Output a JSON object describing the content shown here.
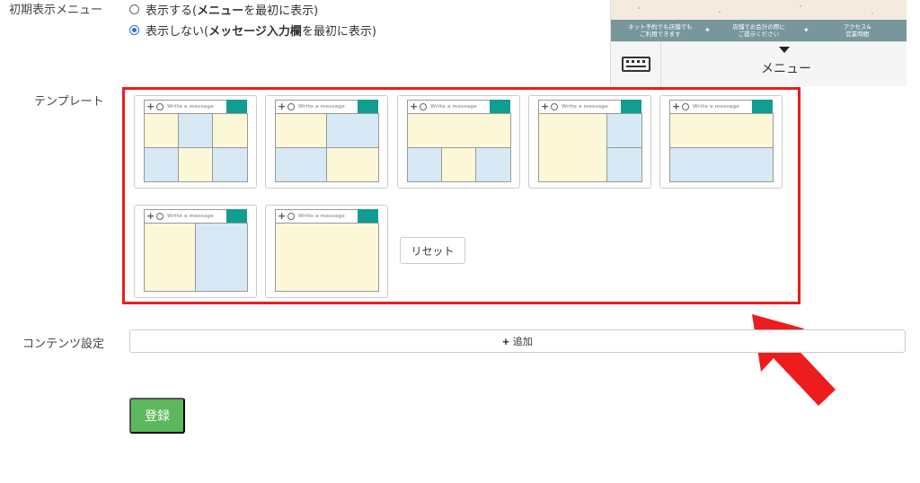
{
  "initial_menu": {
    "label": "初期表示メニュー",
    "options": [
      {
        "text_before": "表示する(",
        "bold": "メニュー",
        "text_after": "を最初に表示)",
        "selected": false
      },
      {
        "text_before": "表示しない(",
        "bold": "メッセージ入力欄",
        "text_after": "を最初に表示)",
        "selected": true
      }
    ]
  },
  "preview": {
    "band_items": [
      "ネット予約でも店舗でも\nご利用できます",
      "店舗でお会計の際に\nご提示ください",
      "アクセス&\n営業時間"
    ],
    "menu_label": "メニュー",
    "keyboard_icon": "keyboard-icon"
  },
  "templates": {
    "label": "テンプレート",
    "message_placeholder": "Write a message",
    "reset_label": "リセット"
  },
  "content_settings": {
    "label": "コンテンツ設定",
    "add_label": "追加"
  },
  "submit_label": "登録",
  "colors": {
    "highlight_border": "#ee1c1c",
    "send_button": "#109e91",
    "cell_yellow": "#fbf7d7",
    "cell_blue": "#d7e9f4",
    "submit_green": "#5cb85c",
    "band": "#77979c"
  }
}
